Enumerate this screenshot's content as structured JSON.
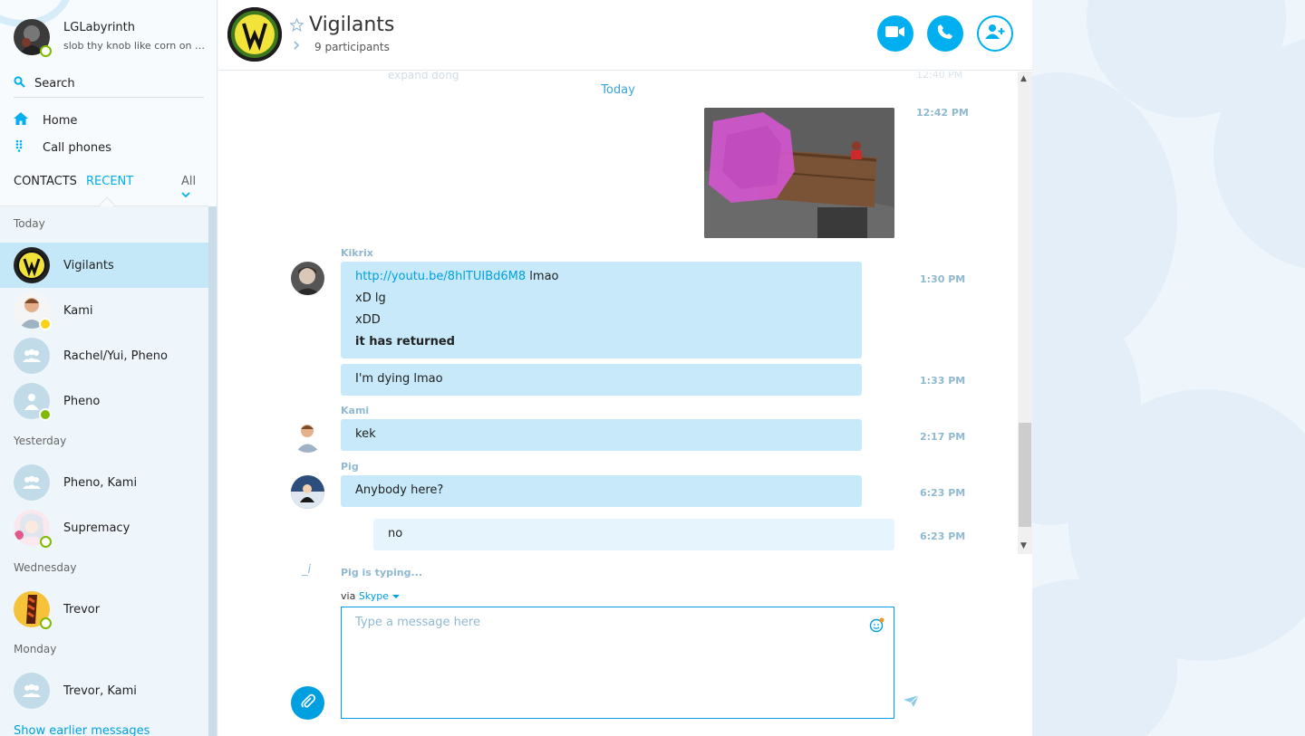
{
  "profile": {
    "name": "LGLabyrinth",
    "mood": "slob thy knob like corn on the cob"
  },
  "search": {
    "label": "Search"
  },
  "nav": {
    "home": "Home",
    "call_phones": "Call phones"
  },
  "tabs": {
    "contacts": "CONTACTS",
    "recent": "RECENT",
    "filter": "All"
  },
  "groups": {
    "today": "Today",
    "yesterday": "Yesterday",
    "wednesday": "Wednesday",
    "monday": "Monday"
  },
  "recent": [
    {
      "name": "Vigilants"
    },
    {
      "name": "Kami"
    },
    {
      "name": "Rachel/Yui, Pheno"
    },
    {
      "name": "Pheno"
    },
    {
      "name": "Pheno, Kami"
    },
    {
      "name": "Supremacy"
    },
    {
      "name": "Trevor"
    },
    {
      "name": "Trevor, Kami"
    }
  ],
  "show_earlier": "Show earlier messages",
  "conversation": {
    "title": "Vigilants",
    "participants": "9 participants"
  },
  "messages": {
    "faded_text": "expand dong",
    "faded_time": "12:40 PM",
    "date_separator": "Today",
    "image_time": "12:42 PM",
    "kikrix": {
      "sender": "Kikrix",
      "link": "http://youtu.be/8hlTUIBd6M8",
      "link_suffix": " lmao",
      "line2": "xD lg",
      "line3": "xDD",
      "line4": "it has returned",
      "time1": "1:30 PM",
      "second": "I'm dying lmao",
      "time2": "1:33 PM"
    },
    "kami": {
      "sender": "Kami",
      "text": "kek",
      "time": "2:17 PM"
    },
    "pig": {
      "sender": "Pig",
      "text": "Anybody here?",
      "time": "6:23 PM"
    },
    "own": {
      "text": "no",
      "time": "6:23 PM"
    }
  },
  "typing": {
    "indicator": "_i",
    "text": "Pig is typing..."
  },
  "compose": {
    "via": "via",
    "service": "Skype",
    "placeholder": "Type a message here"
  },
  "colors": {
    "accent": "#00aff0",
    "bubble": "#c7e9f9",
    "own_bubble": "#e6f5fd",
    "active_row": "#c5e8f8",
    "online": "#7fba00"
  },
  "icons": [
    "search-icon",
    "home-icon",
    "dialpad-icon",
    "chevron-down-icon",
    "star-icon",
    "video-call-icon",
    "phone-icon",
    "add-person-icon",
    "emoji-icon",
    "attach-icon",
    "send-icon"
  ]
}
